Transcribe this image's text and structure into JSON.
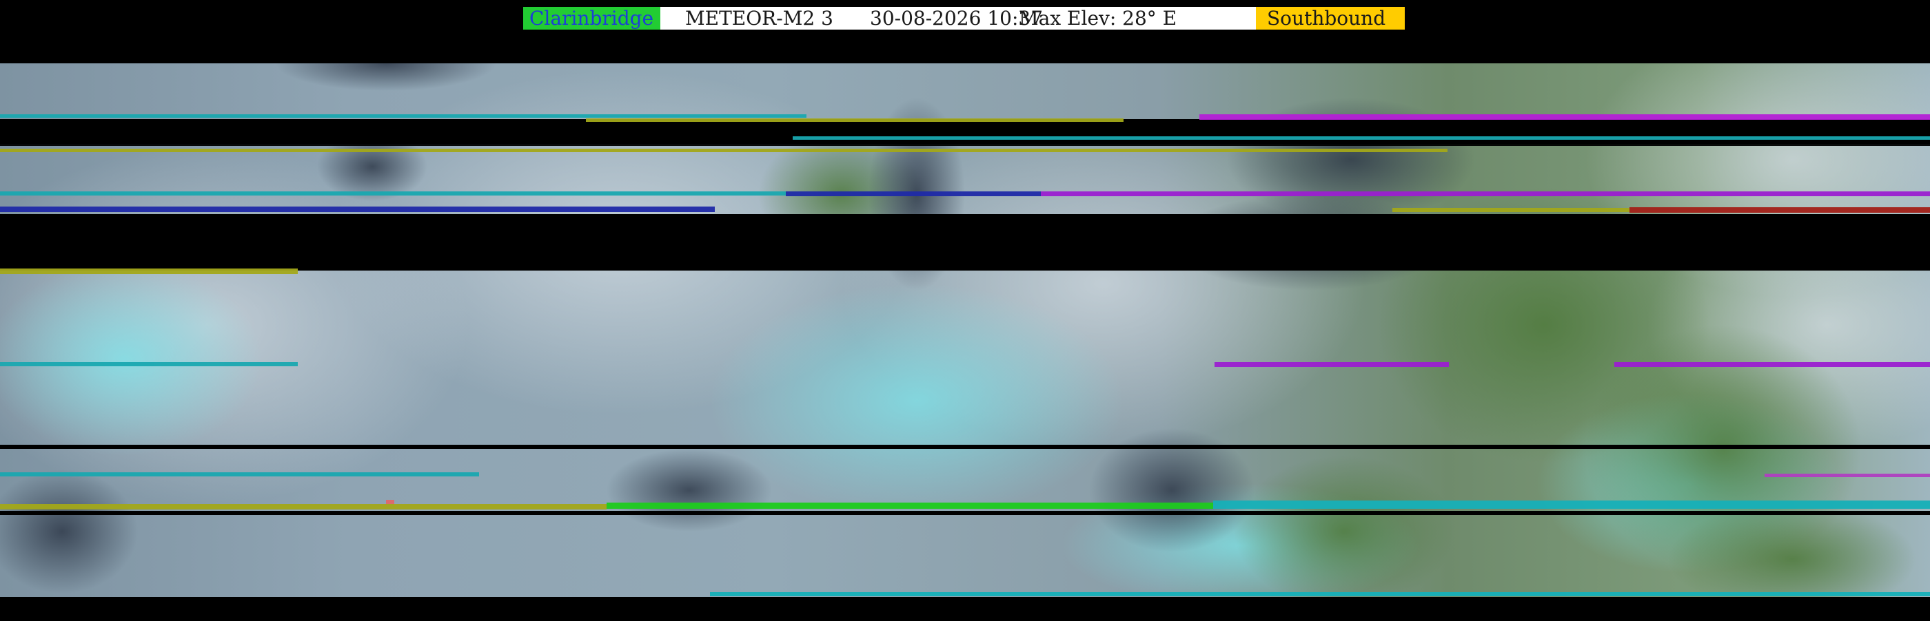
{
  "header": {
    "station": "Clarinbridge",
    "satellite": "METEOR-M2 3",
    "datetime": "30-08-2026 10:37",
    "max_elevation": "Max Elev: 28° E",
    "direction": "Southbound"
  },
  "colors": {
    "station_bg": "#22cc33",
    "station_text": "#1d3fd6",
    "info_bg": "#ffffff",
    "direction_bg": "#ffcc00",
    "background": "#000000"
  }
}
